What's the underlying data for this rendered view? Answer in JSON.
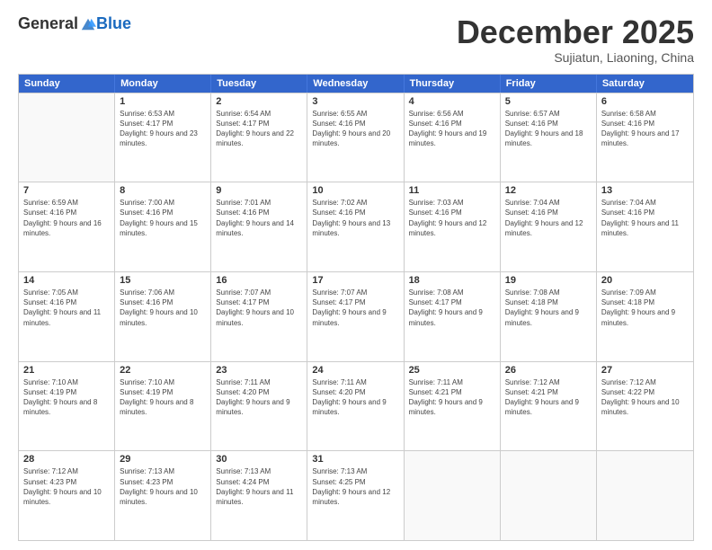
{
  "logo": {
    "general": "General",
    "blue": "Blue"
  },
  "header": {
    "month": "December 2025",
    "location": "Sujiatun, Liaoning, China"
  },
  "weekdays": [
    "Sunday",
    "Monday",
    "Tuesday",
    "Wednesday",
    "Thursday",
    "Friday",
    "Saturday"
  ],
  "weeks": [
    [
      {
        "day": "",
        "sunrise": "",
        "sunset": "",
        "daylight": ""
      },
      {
        "day": "1",
        "sunrise": "Sunrise: 6:53 AM",
        "sunset": "Sunset: 4:17 PM",
        "daylight": "Daylight: 9 hours and 23 minutes."
      },
      {
        "day": "2",
        "sunrise": "Sunrise: 6:54 AM",
        "sunset": "Sunset: 4:17 PM",
        "daylight": "Daylight: 9 hours and 22 minutes."
      },
      {
        "day": "3",
        "sunrise": "Sunrise: 6:55 AM",
        "sunset": "Sunset: 4:16 PM",
        "daylight": "Daylight: 9 hours and 20 minutes."
      },
      {
        "day": "4",
        "sunrise": "Sunrise: 6:56 AM",
        "sunset": "Sunset: 4:16 PM",
        "daylight": "Daylight: 9 hours and 19 minutes."
      },
      {
        "day": "5",
        "sunrise": "Sunrise: 6:57 AM",
        "sunset": "Sunset: 4:16 PM",
        "daylight": "Daylight: 9 hours and 18 minutes."
      },
      {
        "day": "6",
        "sunrise": "Sunrise: 6:58 AM",
        "sunset": "Sunset: 4:16 PM",
        "daylight": "Daylight: 9 hours and 17 minutes."
      }
    ],
    [
      {
        "day": "7",
        "sunrise": "Sunrise: 6:59 AM",
        "sunset": "Sunset: 4:16 PM",
        "daylight": "Daylight: 9 hours and 16 minutes."
      },
      {
        "day": "8",
        "sunrise": "Sunrise: 7:00 AM",
        "sunset": "Sunset: 4:16 PM",
        "daylight": "Daylight: 9 hours and 15 minutes."
      },
      {
        "day": "9",
        "sunrise": "Sunrise: 7:01 AM",
        "sunset": "Sunset: 4:16 PM",
        "daylight": "Daylight: 9 hours and 14 minutes."
      },
      {
        "day": "10",
        "sunrise": "Sunrise: 7:02 AM",
        "sunset": "Sunset: 4:16 PM",
        "daylight": "Daylight: 9 hours and 13 minutes."
      },
      {
        "day": "11",
        "sunrise": "Sunrise: 7:03 AM",
        "sunset": "Sunset: 4:16 PM",
        "daylight": "Daylight: 9 hours and 12 minutes."
      },
      {
        "day": "12",
        "sunrise": "Sunrise: 7:04 AM",
        "sunset": "Sunset: 4:16 PM",
        "daylight": "Daylight: 9 hours and 12 minutes."
      },
      {
        "day": "13",
        "sunrise": "Sunrise: 7:04 AM",
        "sunset": "Sunset: 4:16 PM",
        "daylight": "Daylight: 9 hours and 11 minutes."
      }
    ],
    [
      {
        "day": "14",
        "sunrise": "Sunrise: 7:05 AM",
        "sunset": "Sunset: 4:16 PM",
        "daylight": "Daylight: 9 hours and 11 minutes."
      },
      {
        "day": "15",
        "sunrise": "Sunrise: 7:06 AM",
        "sunset": "Sunset: 4:16 PM",
        "daylight": "Daylight: 9 hours and 10 minutes."
      },
      {
        "day": "16",
        "sunrise": "Sunrise: 7:07 AM",
        "sunset": "Sunset: 4:17 PM",
        "daylight": "Daylight: 9 hours and 10 minutes."
      },
      {
        "day": "17",
        "sunrise": "Sunrise: 7:07 AM",
        "sunset": "Sunset: 4:17 PM",
        "daylight": "Daylight: 9 hours and 9 minutes."
      },
      {
        "day": "18",
        "sunrise": "Sunrise: 7:08 AM",
        "sunset": "Sunset: 4:17 PM",
        "daylight": "Daylight: 9 hours and 9 minutes."
      },
      {
        "day": "19",
        "sunrise": "Sunrise: 7:08 AM",
        "sunset": "Sunset: 4:18 PM",
        "daylight": "Daylight: 9 hours and 9 minutes."
      },
      {
        "day": "20",
        "sunrise": "Sunrise: 7:09 AM",
        "sunset": "Sunset: 4:18 PM",
        "daylight": "Daylight: 9 hours and 9 minutes."
      }
    ],
    [
      {
        "day": "21",
        "sunrise": "Sunrise: 7:10 AM",
        "sunset": "Sunset: 4:19 PM",
        "daylight": "Daylight: 9 hours and 8 minutes."
      },
      {
        "day": "22",
        "sunrise": "Sunrise: 7:10 AM",
        "sunset": "Sunset: 4:19 PM",
        "daylight": "Daylight: 9 hours and 8 minutes."
      },
      {
        "day": "23",
        "sunrise": "Sunrise: 7:11 AM",
        "sunset": "Sunset: 4:20 PM",
        "daylight": "Daylight: 9 hours and 9 minutes."
      },
      {
        "day": "24",
        "sunrise": "Sunrise: 7:11 AM",
        "sunset": "Sunset: 4:20 PM",
        "daylight": "Daylight: 9 hours and 9 minutes."
      },
      {
        "day": "25",
        "sunrise": "Sunrise: 7:11 AM",
        "sunset": "Sunset: 4:21 PM",
        "daylight": "Daylight: 9 hours and 9 minutes."
      },
      {
        "day": "26",
        "sunrise": "Sunrise: 7:12 AM",
        "sunset": "Sunset: 4:21 PM",
        "daylight": "Daylight: 9 hours and 9 minutes."
      },
      {
        "day": "27",
        "sunrise": "Sunrise: 7:12 AM",
        "sunset": "Sunset: 4:22 PM",
        "daylight": "Daylight: 9 hours and 10 minutes."
      }
    ],
    [
      {
        "day": "28",
        "sunrise": "Sunrise: 7:12 AM",
        "sunset": "Sunset: 4:23 PM",
        "daylight": "Daylight: 9 hours and 10 minutes."
      },
      {
        "day": "29",
        "sunrise": "Sunrise: 7:13 AM",
        "sunset": "Sunset: 4:23 PM",
        "daylight": "Daylight: 9 hours and 10 minutes."
      },
      {
        "day": "30",
        "sunrise": "Sunrise: 7:13 AM",
        "sunset": "Sunset: 4:24 PM",
        "daylight": "Daylight: 9 hours and 11 minutes."
      },
      {
        "day": "31",
        "sunrise": "Sunrise: 7:13 AM",
        "sunset": "Sunset: 4:25 PM",
        "daylight": "Daylight: 9 hours and 12 minutes."
      },
      {
        "day": "",
        "sunrise": "",
        "sunset": "",
        "daylight": ""
      },
      {
        "day": "",
        "sunrise": "",
        "sunset": "",
        "daylight": ""
      },
      {
        "day": "",
        "sunrise": "",
        "sunset": "",
        "daylight": ""
      }
    ]
  ]
}
